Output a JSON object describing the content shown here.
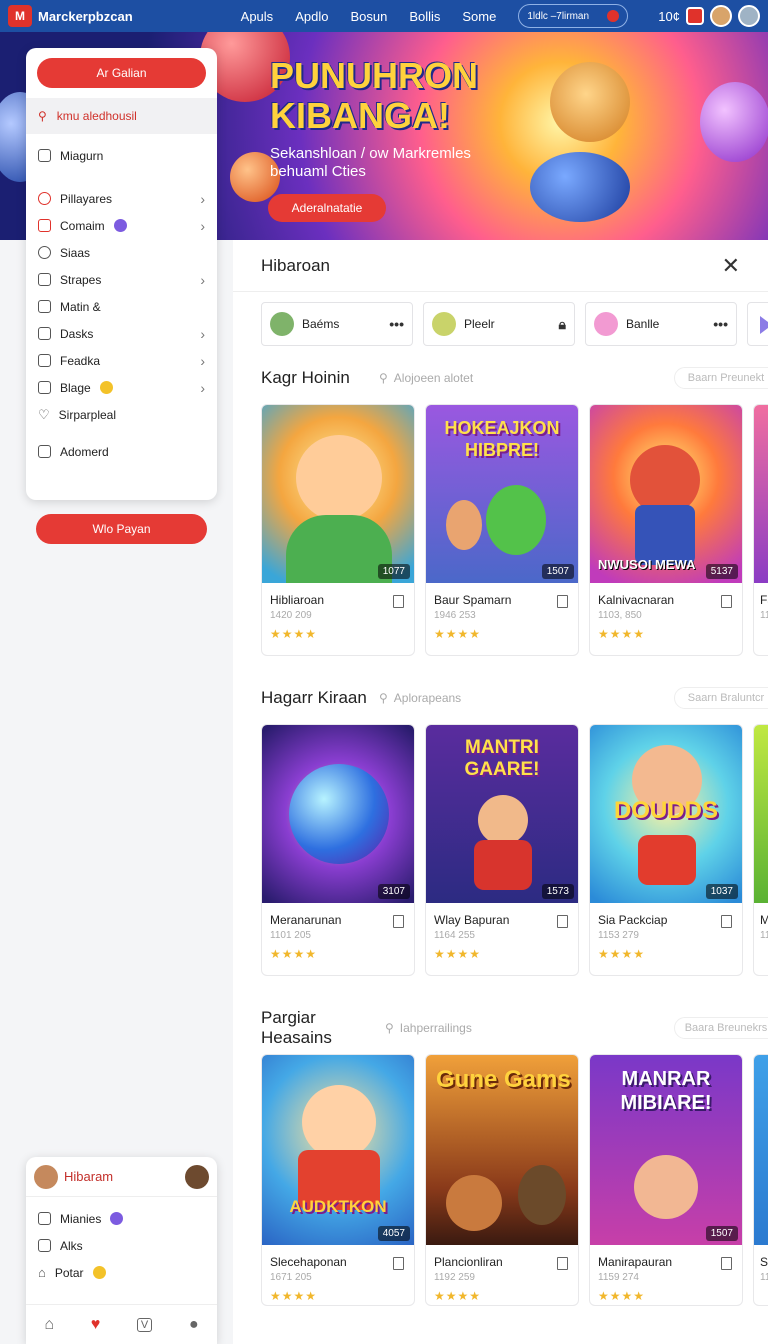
{
  "topbar": {
    "brand": "Marckerpbzcan",
    "nav": [
      "Apuls",
      "Apdlo",
      "Bosun",
      "Bollis",
      "Some"
    ],
    "search_text": "1ldlc –7lirman",
    "count_label": "10¢"
  },
  "hero": {
    "title_line1": "PUNUHRON",
    "title_line2": "KIBANGA!",
    "subtitle": "Sekanshloan / ow Markremles behuaml Cties",
    "button": "Aderalnatatie"
  },
  "sidebar": {
    "top_button": "Ar Galian",
    "search_text": "kmu aledhousil",
    "items": [
      {
        "label": "Miagurn",
        "chevron": false
      },
      {
        "label": "Pillayares",
        "chevron": true
      },
      {
        "label": "Comaim",
        "chevron": true
      },
      {
        "label": "Siaas",
        "chevron": false
      },
      {
        "label": "Strapes",
        "chevron": true
      },
      {
        "label": "Matin &",
        "chevron": false
      },
      {
        "label": "Dasks",
        "chevron": true
      },
      {
        "label": "Feadka",
        "chevron": true
      },
      {
        "label": "Blage",
        "chevron": true
      },
      {
        "label": "Sirparpleal",
        "chevron": false
      },
      {
        "label": "Adomerd",
        "chevron": false
      }
    ],
    "below_button": "Wlo Payan"
  },
  "content": {
    "header_title": "Hibaroan",
    "users": [
      {
        "name": "Baéms",
        "action": "•••"
      },
      {
        "name": "Pleelr",
        "action": "lock"
      },
      {
        "name": "Banlle",
        "action": "•••"
      }
    ]
  },
  "sections": [
    {
      "title": "Kagr Hoinin",
      "search": "Alojoeen alotet",
      "pill": "Baarn Preunekt",
      "cards": [
        {
          "title": "Hibliaroan",
          "meta": "1420 209",
          "count": "1077",
          "caption": ""
        },
        {
          "title": "Baur Spamarn",
          "meta": "1946 253",
          "count": "1507",
          "caption": "HOKEAJKON HIBPRE!"
        },
        {
          "title": "Kalnivacnaran",
          "meta": "1103, 850",
          "count": "5137",
          "caption": "NWUSOI MEWA"
        },
        {
          "title": "Far",
          "meta": "11",
          "count": "",
          "caption": ""
        }
      ]
    },
    {
      "title": "Hagarr Kiraan",
      "search": "Aplorapeans",
      "pill": "Saarn Braluntcr",
      "cards": [
        {
          "title": "Meranarunan",
          "meta": "1101 205",
          "count": "3107",
          "caption": ""
        },
        {
          "title": "Wlay Bapuran",
          "meta": "1164 255",
          "count": "1573",
          "caption": "MANTRI GAARE!"
        },
        {
          "title": "Sia Packciap",
          "meta": "1153 279",
          "count": "1037",
          "caption": "DOUDDS"
        },
        {
          "title": "Ma",
          "meta": "11",
          "count": "",
          "caption": ""
        }
      ]
    },
    {
      "title": "Pargiar Heasains",
      "search": "Iahperrailings",
      "pill": "Baara Breunekrs",
      "cards": [
        {
          "title": "Slecehaponan",
          "meta": "1671 205",
          "count": "4057",
          "caption": "AUDKTKON"
        },
        {
          "title": "Plancionliran",
          "meta": "1192 259",
          "count": "",
          "caption": "Gune Gams"
        },
        {
          "title": "Manirapauran",
          "meta": "1159 274",
          "count": "1507",
          "caption": "MANRAR MIBIARE!"
        },
        {
          "title": "Sai",
          "meta": "11",
          "count": "",
          "caption": ""
        }
      ]
    }
  ],
  "bottom_panel": {
    "user": "Hibaram",
    "items": [
      "Mianies",
      "Alks",
      "Potar"
    ]
  },
  "colors": {
    "brand_blue": "#1d4fa3",
    "accent_red": "#e53a35",
    "star": "#f1b72c"
  }
}
